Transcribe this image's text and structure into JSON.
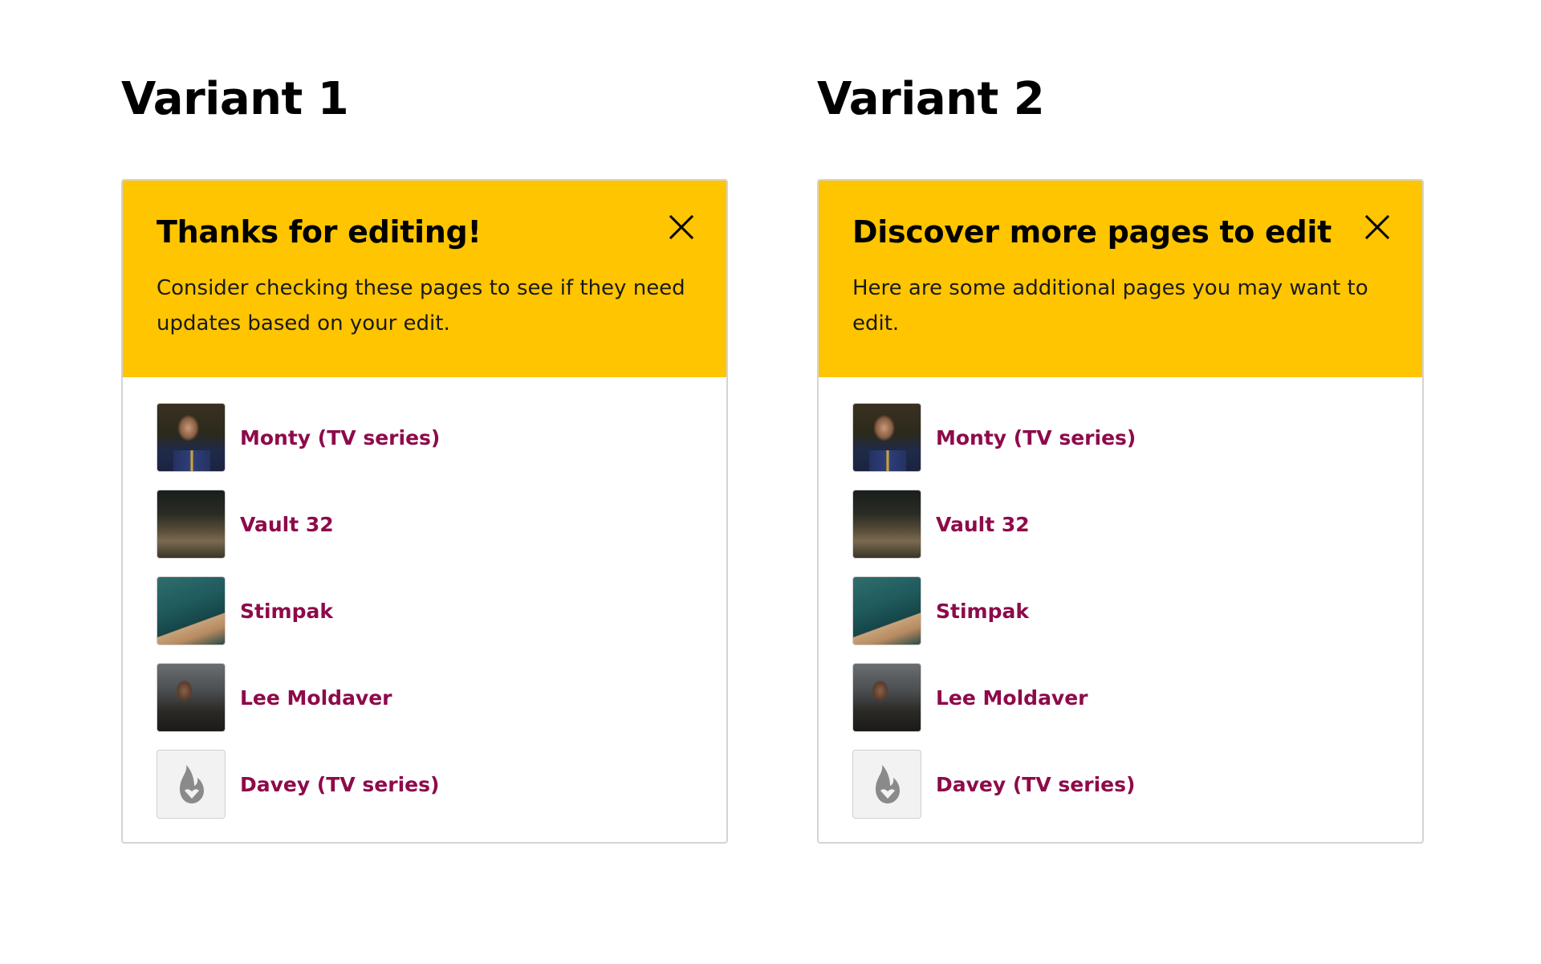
{
  "variants": [
    {
      "title": "Variant 1",
      "heading": "Thanks for editing!",
      "description": "Consider checking these pages to see if they need updates based on your edit.",
      "items": [
        {
          "label": "Monty (TV series)",
          "thumbnail": "thumbnail-image"
        },
        {
          "label": "Vault 32",
          "thumbnail": "thumbnail-image"
        },
        {
          "label": "Stimpak",
          "thumbnail": "thumbnail-image"
        },
        {
          "label": "Lee Moldaver",
          "thumbnail": "thumbnail-image"
        },
        {
          "label": "Davey (TV series)",
          "thumbnail": "placeholder-flame-icon"
        }
      ]
    },
    {
      "title": "Variant 2",
      "heading": "Discover more pages to edit",
      "description": "Here are some additional pages you may want to edit.",
      "items": [
        {
          "label": "Monty (TV series)",
          "thumbnail": "thumbnail-image"
        },
        {
          "label": "Vault 32",
          "thumbnail": "thumbnail-image"
        },
        {
          "label": "Stimpak",
          "thumbnail": "thumbnail-image"
        },
        {
          "label": "Lee Moldaver",
          "thumbnail": "thumbnail-image"
        },
        {
          "label": "Davey (TV series)",
          "thumbnail": "placeholder-flame-icon"
        }
      ]
    }
  ],
  "icons": {
    "close": "close-icon",
    "placeholder": "flame-icon"
  },
  "colors": {
    "header_background": "#ffc500",
    "link": "#8e0a4a",
    "card_border": "#d4d4d4",
    "placeholder_background": "#f3f2f3",
    "placeholder_icon": "#8a8a8a"
  }
}
